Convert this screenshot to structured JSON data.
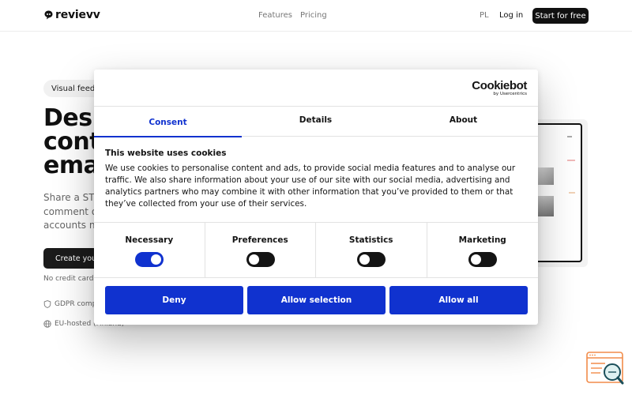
{
  "header": {
    "logo": "revievv",
    "nav": {
      "features": "Features",
      "pricing": "Pricing"
    },
    "lang": "PL",
    "login": "Log in",
    "cta": "Start for free"
  },
  "hero": {
    "badge": "Visual feedb",
    "title_lines": [
      "Desi",
      "cont",
      "ema"
    ],
    "subtitle_lines": [
      "Share a STE",
      "comment o",
      "accounts ne"
    ],
    "cta": "Create you",
    "no_credit": "No credit card",
    "features": [
      {
        "icon": "shield-icon",
        "label": "GDPR comp"
      },
      {
        "icon": "globe-icon",
        "label": "EU-hosted (Finland)"
      }
    ]
  },
  "cookie": {
    "brand": "Cookiebot",
    "brand_by": "by Usercentrics",
    "tabs": [
      "Consent",
      "Details",
      "About"
    ],
    "active_tab": "Consent",
    "title": "This website uses cookies",
    "body": "We use cookies to personalise content and ads, to provide social media features and to analyse our traffic. We also share information about your use of our site with our social media, advertising and analytics partners who may combine it with other information that you’ve provided to them or that they’ve collected from your use of their services.",
    "categories": [
      {
        "label": "Necessary",
        "enabled": true
      },
      {
        "label": "Preferences",
        "enabled": false
      },
      {
        "label": "Statistics",
        "enabled": false
      },
      {
        "label": "Marketing",
        "enabled": false
      }
    ],
    "buttons": {
      "deny": "Deny",
      "selection": "Allow selection",
      "all": "Allow all"
    },
    "accent": "#1032cf"
  },
  "widget": {
    "icon": "search-feedback-icon",
    "accent": "#f28c4a"
  }
}
